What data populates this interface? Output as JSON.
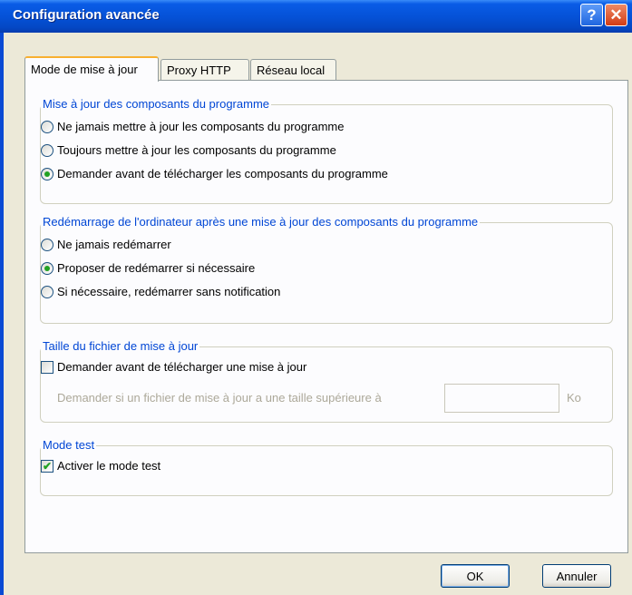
{
  "window": {
    "title": "Configuration avancée",
    "help_symbol": "?",
    "close_symbol": "✕"
  },
  "tabs": [
    {
      "label": "Mode de mise à jour",
      "active": true
    },
    {
      "label": "Proxy HTTP",
      "active": false
    },
    {
      "label": "Réseau local",
      "active": false
    }
  ],
  "groups": {
    "program_update": {
      "title": "Mise à jour des composants du programme",
      "options": [
        {
          "label": "Ne jamais mettre à jour les composants du programme",
          "checked": false
        },
        {
          "label": "Toujours mettre à jour les composants du programme",
          "checked": false
        },
        {
          "label": "Demander avant de télécharger les composants du programme",
          "checked": true
        }
      ]
    },
    "restart": {
      "title": "Redémarrage de l'ordinateur après une mise à jour des composants du programme",
      "options": [
        {
          "label": "Ne jamais redémarrer",
          "checked": false
        },
        {
          "label": "Proposer de redémarrer si nécessaire",
          "checked": true
        },
        {
          "label": "Si nécessaire, redémarrer sans notification",
          "checked": false
        }
      ]
    },
    "file_size": {
      "title": "Taille du fichier de mise à jour",
      "checkbox_label": "Demander avant de télécharger une mise à jour",
      "checkbox_checked": false,
      "size_prompt": "Demander si un fichier de mise à jour a une taille supérieure à",
      "size_value": "",
      "unit": "Ko"
    },
    "test_mode": {
      "title": "Mode test",
      "checkbox_label": "Activer le mode test",
      "checkbox_checked": true
    }
  },
  "buttons": {
    "ok": "OK",
    "cancel": "Annuler"
  },
  "check_glyph": "✔"
}
